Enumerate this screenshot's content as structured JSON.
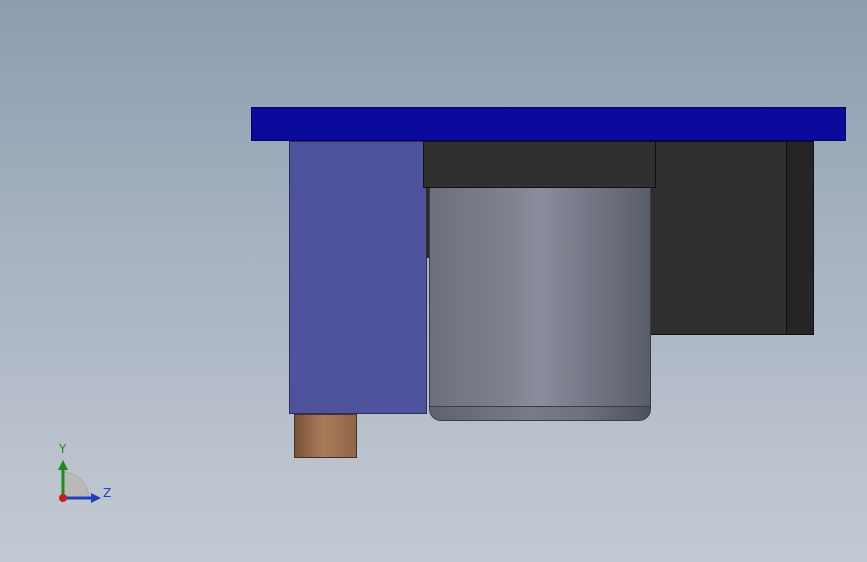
{
  "viewport": {
    "background_top": "#8c9daf",
    "background_bottom": "#c4cad3"
  },
  "model_parts": [
    {
      "name": "top-plate",
      "color": "#0a0a9c"
    },
    {
      "name": "blue-block",
      "color": "#4f529c"
    },
    {
      "name": "copper-pin",
      "color": "#a87c5a"
    },
    {
      "name": "dark-cap",
      "color": "#303030"
    },
    {
      "name": "cylinder",
      "color": "#7e828f"
    },
    {
      "name": "dark-body",
      "color": "#2f2f2f"
    }
  ],
  "triad": {
    "y_label": "Y",
    "z_label": "Z",
    "y_color": "#1f8a1f",
    "z_color": "#1f3fbf",
    "x_color": "#c81e1e"
  }
}
